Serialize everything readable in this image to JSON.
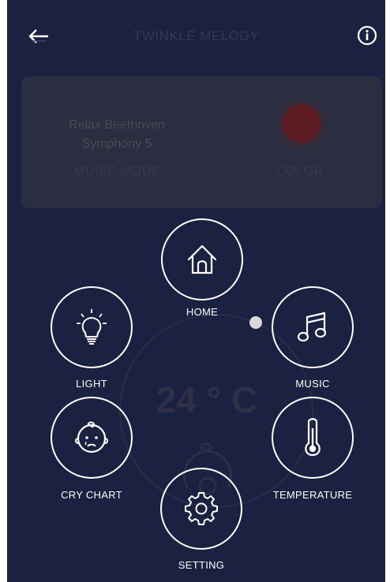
{
  "header": {
    "title": "TWINKLE MELODY",
    "back_icon": "arrow-left-icon",
    "info_icon": "info-icon"
  },
  "status_card": {
    "track_line1": "Relax Beethoven",
    "track_line2": "Symphony 5",
    "mode_label": "MUSIC MODE",
    "color_label": "COLOR",
    "current_color": "#5c1c21"
  },
  "background": {
    "temperature": "24 ° C"
  },
  "menu": {
    "home": "HOME",
    "light": "LIGHT",
    "music": "MUSIC",
    "cry_chart": "CRY CHART",
    "temperature": "TEMPERATURE",
    "setting": "SETTING"
  },
  "colors": {
    "background": "#1b2140",
    "card": "#2a2e40",
    "accent": "#ffffff"
  }
}
